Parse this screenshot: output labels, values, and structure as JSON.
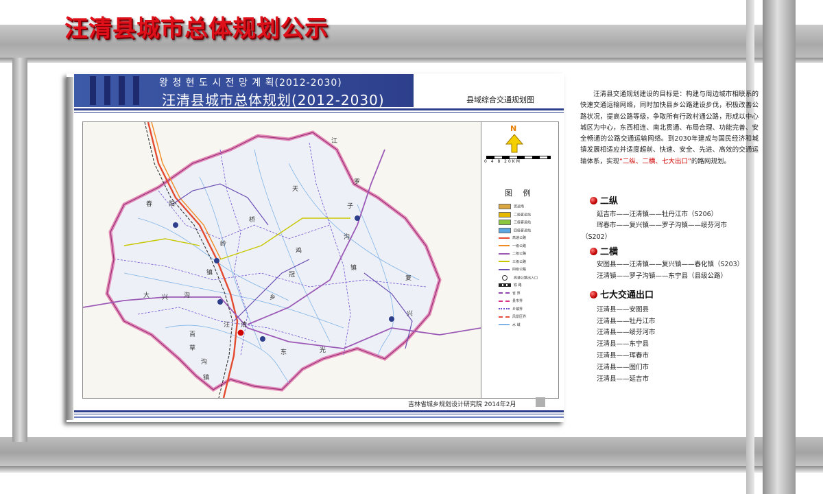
{
  "title": "汪清县城市总体规划公示",
  "panel": {
    "header_korean": "왕 청 현 도 시 전 망 계 획(2012-2030)",
    "header_chinese": "汪清县城市总体规划(2012-2030)",
    "sheet_title": "县域综合交通规划图",
    "footer": "吉林省城乡规划设计研究院  2014年2月"
  },
  "map": {
    "north_label": "N",
    "scale_text": "0 4 8     20KM",
    "legend_title": "图 例",
    "legend": [
      {
        "label": "货运场",
        "color": "#d9a640",
        "kind": "box"
      },
      {
        "label": "二级客运站",
        "color": "#e6b800",
        "kind": "box"
      },
      {
        "label": "三级客运站",
        "color": "#8cc63f",
        "kind": "box"
      },
      {
        "label": "四级客运站",
        "color": "#5aa9e6",
        "kind": "box"
      },
      {
        "label": "高速公路",
        "color": "#e34a2f",
        "kind": "line"
      },
      {
        "label": "一级公路",
        "color": "#f08a24",
        "kind": "line"
      },
      {
        "label": "二级公路",
        "color": "#9b59b6",
        "kind": "line"
      },
      {
        "label": "三级公路",
        "color": "#c7c700",
        "kind": "line"
      },
      {
        "label": "四级公路",
        "color": "#6a4fb3",
        "kind": "line"
      },
      {
        "label": "高速公路出入口",
        "color": "#333333",
        "kind": "circle"
      },
      {
        "label": "铁 路",
        "color": "#222222",
        "kind": "rail"
      },
      {
        "label": "省 界",
        "color": "#8e44ad",
        "kind": "dash"
      },
      {
        "label": "县市界",
        "color": "#d63384",
        "kind": "dash"
      },
      {
        "label": "乡镇界",
        "color": "#6c4fd0",
        "kind": "dot"
      },
      {
        "label": "风景区界",
        "color": "#e74c3c",
        "kind": "dash"
      },
      {
        "label": "水 域",
        "color": "#7fb3e6",
        "kind": "line"
      }
    ],
    "place_labels": [
      "天",
      "桥",
      "子",
      "罗",
      "沟",
      "春",
      "阳",
      "岭",
      "鸡",
      "冠",
      "乡",
      "镇",
      "大",
      "兴",
      "沟",
      "汪",
      "清",
      "复",
      "兴",
      "光",
      "东",
      "百",
      "草",
      "沟",
      "镇",
      "江",
      "镇"
    ]
  },
  "side": {
    "intro_main": "汪清县交通规划建设的目标是：构建与周边城市相联系的快速交通运输网络，同时加快县乡公路建设步伐，积极改善公路状况，提高公路等级，争取所有行政村通公路，形成以中心城区为中心，东西相连、南北贯通、布局合理、功能完善、安全畅通的公路交通运输网络。到2030年建成与国民经济和城镇发展相适应并适度超前、快速、安全、先进、高效的交通运输体系，实现",
    "intro_highlight": "“二纵、二横、七大出口”",
    "intro_end": "的路网规划。",
    "sections": [
      {
        "title": "二纵",
        "lines": [
          "延吉市——汪清镇——牡丹江市（S206）",
          "珲春市——复兴镇——罗子沟镇——绥芬河市",
          "（S202）"
        ]
      },
      {
        "title": "二横",
        "lines": [
          "安图县——汪清镇——复兴镇——春化镇（S203）",
          "汪清镇——罗子沟镇——东宁县（县级公路）"
        ]
      },
      {
        "title": "七大交通出口",
        "lines": [
          "汪清县——安图县",
          "汪清县——牡丹江市",
          "汪清县——绥芬河市",
          "汪清县——东宁县",
          "汪清县——珲春市",
          "汪清县——图们市",
          "汪清县——延吉市"
        ]
      }
    ]
  }
}
